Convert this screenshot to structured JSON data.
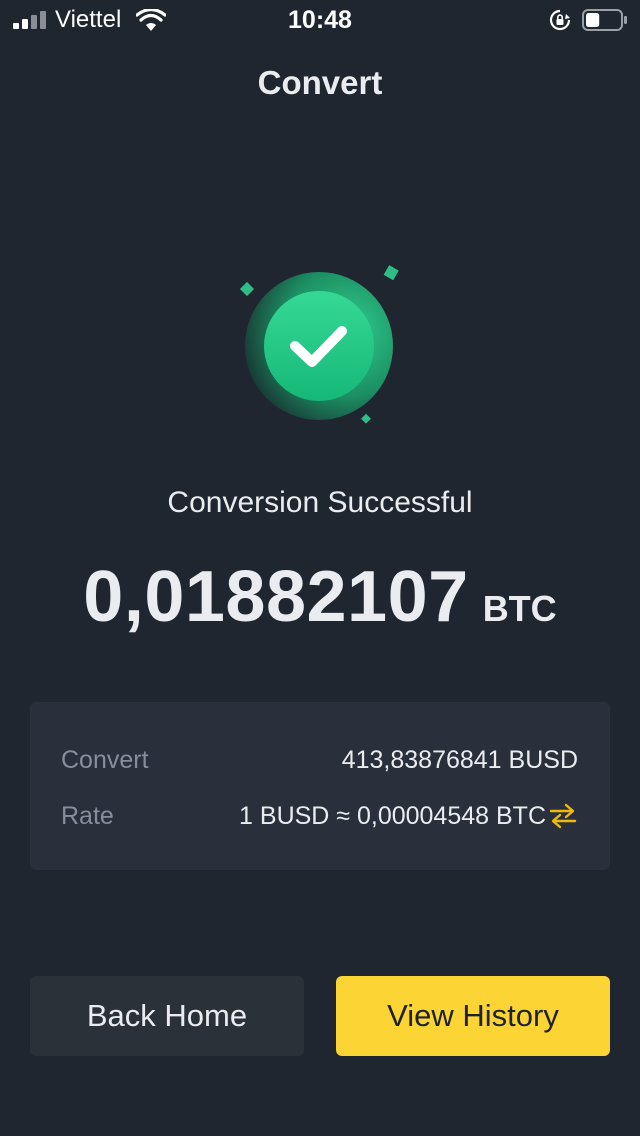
{
  "status_bar": {
    "carrier": "Viettel",
    "time": "10:48",
    "battery_level": 0.4
  },
  "header": {
    "title": "Convert"
  },
  "result": {
    "message": "Conversion Successful",
    "amount": "0,01882107",
    "unit": "BTC"
  },
  "details": {
    "convert_label": "Convert",
    "convert_value": "413,83876841 BUSD",
    "rate_label": "Rate",
    "rate_value": "1 BUSD ≈ 0,00004548 BTC"
  },
  "actions": {
    "back_home_label": "Back Home",
    "view_history_label": "View History"
  },
  "colors": {
    "background": "#1f2630",
    "card": "#29303b",
    "success_green": "#2ebd85",
    "accent_yellow": "#fcd535",
    "muted_text": "#848e9c"
  }
}
